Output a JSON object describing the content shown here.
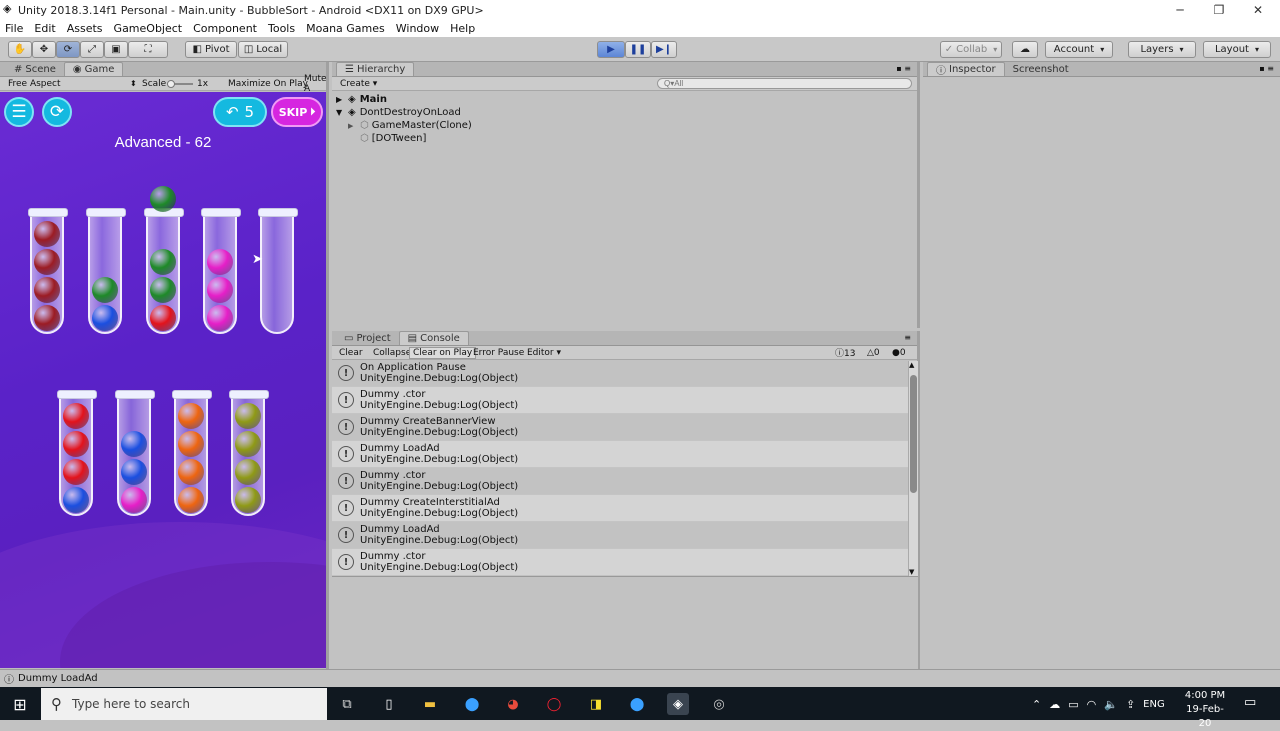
{
  "window": {
    "title": "Unity 2018.3.14f1 Personal - Main.unity - BubbleSort - Android <DX11 on DX9 GPU>",
    "controls": [
      "─",
      "❐",
      "✕"
    ]
  },
  "menu": [
    "File",
    "Edit",
    "Assets",
    "GameObject",
    "Component",
    "Tools",
    "Moana Games",
    "Window",
    "Help"
  ],
  "toolbar": {
    "pivot": "Pivot",
    "local": "Local",
    "collab": "Collab",
    "account": "Account",
    "layers": "Layers",
    "layout": "Layout"
  },
  "game_panel": {
    "tabs": [
      "Scene",
      "Game"
    ],
    "aspect": "Free Aspect",
    "scale_label": "Scale",
    "scale_value": "1x",
    "maximize": "Maximize On Play",
    "mute": "Mute A"
  },
  "game": {
    "level_title": "Advanced - 62",
    "undo_count": "5",
    "skip_label": "SKIP",
    "colors": {
      "darkred": "#9c1c24",
      "green": "#1e8a28",
      "blue": "#1b4fe0",
      "red": "#e3131b",
      "magenta": "#e61fc8",
      "orange": "#ee6510",
      "olive": "#8f9a16"
    }
  },
  "hierarchy": {
    "tab": "Hierarchy",
    "create": "Create",
    "search_placeholder": "Q▾All",
    "items": [
      "Main",
      "DontDestroyOnLoad",
      "GameMaster(Clone)",
      "[DOTween]"
    ]
  },
  "inspector": {
    "tabs": [
      "Inspector",
      "Screenshot"
    ]
  },
  "console": {
    "tabs": [
      "Project",
      "Console"
    ],
    "buttons": [
      "Clear",
      "Collapse",
      "Clear on Play",
      "Error Pause",
      "Editor"
    ],
    "counts": {
      "log": "13",
      "warn": "0",
      "error": "0"
    },
    "entries": [
      {
        "msg": "On Application Pause",
        "src": "UnityEngine.Debug:Log(Object)"
      },
      {
        "msg": "Dummy .ctor",
        "src": "UnityEngine.Debug:Log(Object)"
      },
      {
        "msg": "Dummy CreateBannerView",
        "src": "UnityEngine.Debug:Log(Object)"
      },
      {
        "msg": "Dummy LoadAd",
        "src": "UnityEngine.Debug:Log(Object)"
      },
      {
        "msg": "Dummy .ctor",
        "src": "UnityEngine.Debug:Log(Object)"
      },
      {
        "msg": "Dummy CreateInterstitialAd",
        "src": "UnityEngine.Debug:Log(Object)"
      },
      {
        "msg": "Dummy LoadAd",
        "src": "UnityEngine.Debug:Log(Object)"
      },
      {
        "msg": "Dummy .ctor",
        "src": "UnityEngine.Debug:Log(Object)"
      }
    ]
  },
  "statusbar": {
    "text": "Dummy LoadAd"
  },
  "taskbar": {
    "search_placeholder": "Type here to search",
    "lang": "ENG",
    "time": "4:00 PM",
    "date": "19-Feb-20"
  }
}
